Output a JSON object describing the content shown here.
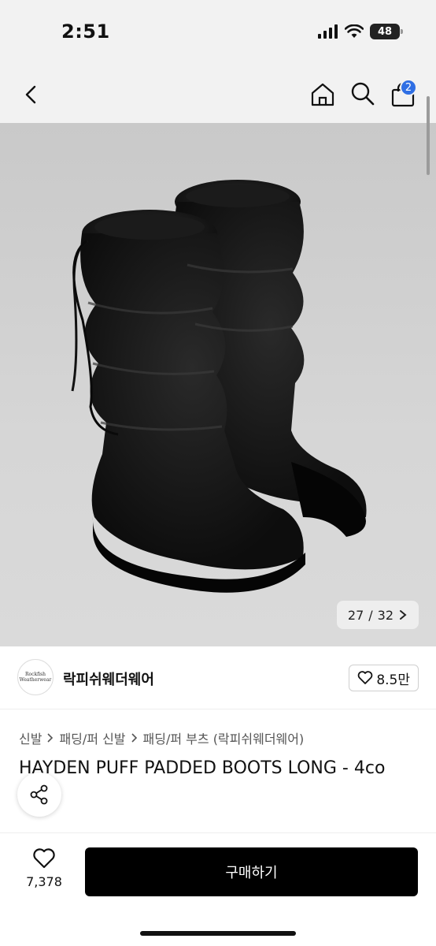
{
  "status_bar": {
    "time": "2:51",
    "battery": "48"
  },
  "nav": {
    "cart_count": "2"
  },
  "gallery": {
    "current": "27",
    "total": "32",
    "separator": "/"
  },
  "seller": {
    "name": "락피쉬웨더웨어",
    "likes": "8.5만",
    "logo_text": "Rockfish Weatherwear"
  },
  "breadcrumb": {
    "items": [
      "신발",
      "패딩/퍼 신발",
      "패딩/퍼 부츠 (락피쉬웨더웨어)"
    ]
  },
  "product": {
    "title": "HAYDEN PUFF PADDED BOOTS LONG - 4co"
  },
  "bottom_bar": {
    "wish_count": "7,378",
    "buy_label": "구매하기"
  },
  "colors": {
    "accent": "#2f6fe4",
    "buy_button": "#000000"
  }
}
